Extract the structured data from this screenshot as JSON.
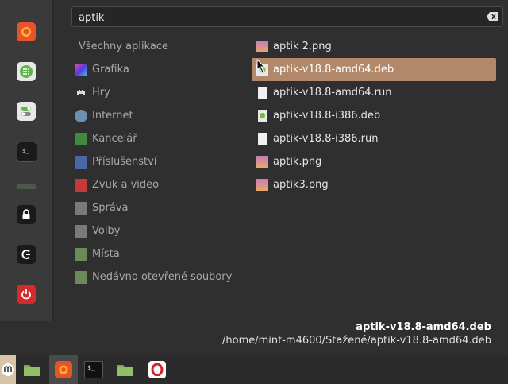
{
  "search": {
    "value": "aptik"
  },
  "categories": [
    {
      "label": "Všechny aplikace",
      "icon": "none"
    },
    {
      "label": "Grafika",
      "icon": "graphics-icon",
      "color": "#b04ad6"
    },
    {
      "label": "Hry",
      "icon": "games-icon",
      "color": "#555555"
    },
    {
      "label": "Internet",
      "icon": "internet-icon",
      "color": "#6a8fb0"
    },
    {
      "label": "Kancelář",
      "icon": "office-icon",
      "color": "#3f8a3f"
    },
    {
      "label": "Příslušenství",
      "icon": "accessories-icon",
      "color": "#4a68a8"
    },
    {
      "label": "Zvuk a video",
      "icon": "sound-video-icon",
      "color": "#c43a3a"
    },
    {
      "label": "Správa",
      "icon": "administration-icon",
      "color": "#7a7a7a"
    },
    {
      "label": "Volby",
      "icon": "preferences-icon",
      "color": "#7a7a7a"
    },
    {
      "label": "Místa",
      "icon": "folder-icon",
      "color": "#6a8a5a"
    },
    {
      "label": "Nedávno otevřené soubory",
      "icon": "folder-icon",
      "color": "#6a8a5a"
    }
  ],
  "results": [
    {
      "label": "aptik 2.png",
      "icon": "image-icon"
    },
    {
      "label": "aptik-v18.8-amd64.deb",
      "icon": "deb-package-icon",
      "selected": true
    },
    {
      "label": "aptik-v18.8-amd64.run",
      "icon": "file-icon"
    },
    {
      "label": "aptik-v18.8-i386.deb",
      "icon": "deb-package-icon"
    },
    {
      "label": "aptik-v18.8-i386.run",
      "icon": "file-icon"
    },
    {
      "label": "aptik.png",
      "icon": "image-icon"
    },
    {
      "label": "aptik3.png",
      "icon": "image-icon"
    }
  ],
  "info": {
    "name": "aptik-v18.8-amd64.deb",
    "path": "/home/mint-m4600/Stažené/aptik-v18.8-amd64.deb"
  },
  "colors": {
    "accent": "#b1896a",
    "panel": "#3a3a3a",
    "background": "#2f2f2f"
  }
}
